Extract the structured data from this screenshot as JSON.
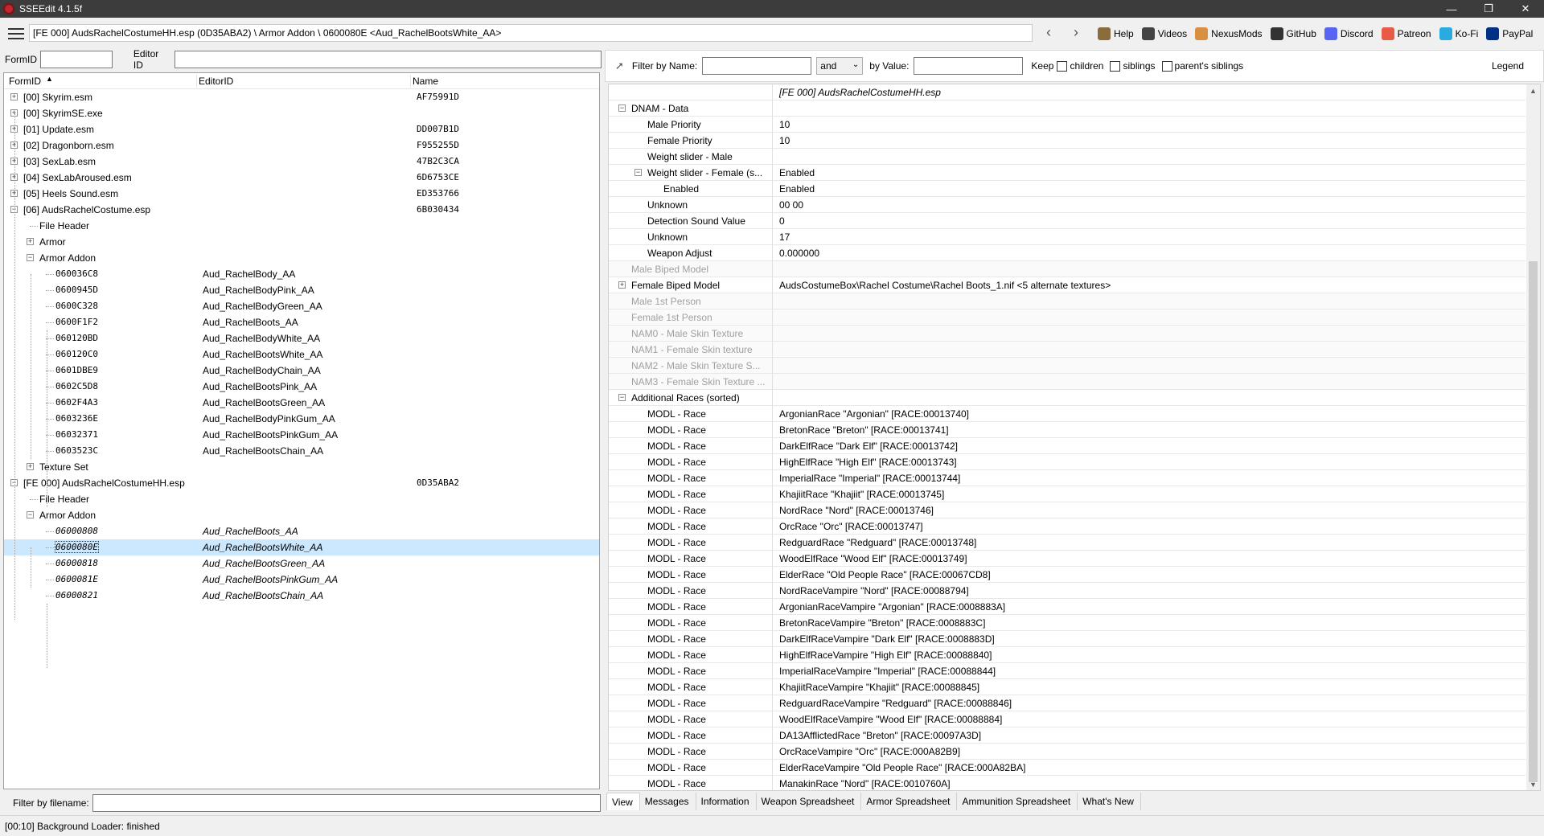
{
  "window": {
    "title": "SSEEdit 4.1.5f"
  },
  "toolbar": {
    "path": "[FE 000] AudsRachelCostumeHH.esp (0D35ABA2) \\ Armor Addon \\ 0600080E <Aud_RachelBootsWhite_AA>",
    "back_glyph": "‹",
    "forward_glyph": "›",
    "links": [
      {
        "label": "Help",
        "color": "#8a6d3b"
      },
      {
        "label": "Videos",
        "color": "#444444"
      },
      {
        "label": "NexusMods",
        "color": "#d98f40"
      },
      {
        "label": "GitHub",
        "color": "#333333"
      },
      {
        "label": "Discord",
        "color": "#5865f2"
      },
      {
        "label": "Patreon",
        "color": "#e85b46"
      },
      {
        "label": "Ko-Fi",
        "color": "#29abe0"
      },
      {
        "label": "PayPal",
        "color": "#003087"
      }
    ]
  },
  "left": {
    "formid_label": "FormID",
    "editorid_label": "Editor ID",
    "columns": [
      "FormID",
      "EditorID",
      "Name"
    ],
    "filename_label": "Filter by filename:",
    "rows": [
      {
        "c1": "[00] Skyrim.esm",
        "c2": "",
        "c3": "AF75991D"
      },
      {
        "c1": "[00] SkyrimSE.exe",
        "c2": "",
        "c3": ""
      },
      {
        "c1": "[01] Update.esm",
        "c2": "",
        "c3": "DD007B1D"
      },
      {
        "c1": "[02] Dragonborn.esm",
        "c2": "",
        "c3": "F955255D"
      },
      {
        "c1": "[03] SexLab.esm",
        "c2": "",
        "c3": "47B2C3CA"
      },
      {
        "c1": "[04] SexLabAroused.esm",
        "c2": "",
        "c3": "6D6753CE"
      },
      {
        "c1": "[05] Heels Sound.esm",
        "c2": "",
        "c3": "ED353766"
      },
      {
        "c1": "[06] AudsRachelCostume.esp",
        "c2": "",
        "c3": "6B030434"
      },
      {
        "c1": "File Header",
        "c2": "",
        "c3": ""
      },
      {
        "c1": "Armor",
        "c2": "",
        "c3": ""
      },
      {
        "c1": "Armor Addon",
        "c2": "",
        "c3": ""
      },
      {
        "c1": "060036C8",
        "c2": "Aud_RachelBody_AA",
        "c3": ""
      },
      {
        "c1": "0600945D",
        "c2": "Aud_RachelBodyPink_AA",
        "c3": ""
      },
      {
        "c1": "0600C328",
        "c2": "Aud_RachelBodyGreen_AA",
        "c3": ""
      },
      {
        "c1": "0600F1F2",
        "c2": "Aud_RachelBoots_AA",
        "c3": ""
      },
      {
        "c1": "060120BD",
        "c2": "Aud_RachelBodyWhite_AA",
        "c3": ""
      },
      {
        "c1": "060120C0",
        "c2": "Aud_RachelBootsWhite_AA",
        "c3": ""
      },
      {
        "c1": "0601DBE9",
        "c2": "Aud_RachelBodyChain_AA",
        "c3": ""
      },
      {
        "c1": "0602C5D8",
        "c2": "Aud_RachelBootsPink_AA",
        "c3": ""
      },
      {
        "c1": "0602F4A3",
        "c2": "Aud_RachelBootsGreen_AA",
        "c3": ""
      },
      {
        "c1": "0603236E",
        "c2": "Aud_RachelBodyPinkGum_AA",
        "c3": ""
      },
      {
        "c1": "06032371",
        "c2": "Aud_RachelBootsPinkGum_AA",
        "c3": ""
      },
      {
        "c1": "0603523C",
        "c2": "Aud_RachelBootsChain_AA",
        "c3": ""
      },
      {
        "c1": "Texture Set",
        "c2": "",
        "c3": ""
      },
      {
        "c1": "[FE 000] AudsRachelCostumeHH.esp",
        "c2": "",
        "c3": "0D35ABA2"
      },
      {
        "c1": "File Header",
        "c2": "",
        "c3": ""
      },
      {
        "c1": "Armor Addon",
        "c2": "",
        "c3": ""
      },
      {
        "c1": "06000808",
        "c2": "Aud_RachelBoots_AA",
        "c3": ""
      },
      {
        "c1": "0600080E",
        "c2": "Aud_RachelBootsWhite_AA",
        "c3": ""
      },
      {
        "c1": "06000818",
        "c2": "Aud_RachelBootsGreen_AA",
        "c3": ""
      },
      {
        "c1": "0600081E",
        "c2": "Aud_RachelBootsPinkGum_AA",
        "c3": ""
      },
      {
        "c1": "06000821",
        "c2": "Aud_RachelBootsChain_AA",
        "c3": ""
      }
    ]
  },
  "right": {
    "filter_name_label": "Filter by Name:",
    "and_value": "and",
    "by_value_label": "by Value:",
    "keep_label": "Keep",
    "children_label": "children",
    "siblings_label": "siblings",
    "parents_siblings_label": "parent's siblings",
    "legend_label": "Legend",
    "header_value": "[FE 000] AudsRachelCostumeHH.esp",
    "rows": [
      {
        "k": "DNAM - Data",
        "v": ""
      },
      {
        "k": "Male Priority",
        "v": "10"
      },
      {
        "k": "Female Priority",
        "v": "10"
      },
      {
        "k": "Weight slider - Male",
        "v": ""
      },
      {
        "k": "Weight slider - Female (s...",
        "v": "Enabled"
      },
      {
        "k": "Enabled",
        "v": "Enabled"
      },
      {
        "k": "Unknown",
        "v": "00 00"
      },
      {
        "k": "Detection Sound Value",
        "v": "0"
      },
      {
        "k": "Unknown",
        "v": "17"
      },
      {
        "k": "Weapon Adjust",
        "v": "0.000000"
      },
      {
        "k": "Male Biped Model",
        "v": ""
      },
      {
        "k": "Female Biped Model",
        "v": "AudsCostumeBox\\Rachel Costume\\Rachel Boots_1.nif <5 alternate textures>"
      },
      {
        "k": "Male 1st Person",
        "v": ""
      },
      {
        "k": "Female 1st Person",
        "v": ""
      },
      {
        "k": "NAM0 - Male Skin Texture",
        "v": ""
      },
      {
        "k": "NAM1 - Female Skin texture",
        "v": ""
      },
      {
        "k": "NAM2 - Male Skin Texture S...",
        "v": ""
      },
      {
        "k": "NAM3 - Female Skin Texture ...",
        "v": ""
      },
      {
        "k": "Additional Races (sorted)",
        "v": ""
      },
      {
        "k": "MODL - Race",
        "v": "ArgonianRace \"Argonian\" [RACE:00013740]"
      },
      {
        "k": "MODL - Race",
        "v": "BretonRace \"Breton\" [RACE:00013741]"
      },
      {
        "k": "MODL - Race",
        "v": "DarkElfRace \"Dark Elf\" [RACE:00013742]"
      },
      {
        "k": "MODL - Race",
        "v": "HighElfRace \"High Elf\" [RACE:00013743]"
      },
      {
        "k": "MODL - Race",
        "v": "ImperialRace \"Imperial\" [RACE:00013744]"
      },
      {
        "k": "MODL - Race",
        "v": "KhajiitRace \"Khajiit\" [RACE:00013745]"
      },
      {
        "k": "MODL - Race",
        "v": "NordRace \"Nord\" [RACE:00013746]"
      },
      {
        "k": "MODL - Race",
        "v": "OrcRace \"Orc\" [RACE:00013747]"
      },
      {
        "k": "MODL - Race",
        "v": "RedguardRace \"Redguard\" [RACE:00013748]"
      },
      {
        "k": "MODL - Race",
        "v": "WoodElfRace \"Wood Elf\" [RACE:00013749]"
      },
      {
        "k": "MODL - Race",
        "v": "ElderRace \"Old People Race\" [RACE:00067CD8]"
      },
      {
        "k": "MODL - Race",
        "v": "NordRaceVampire \"Nord\" [RACE:00088794]"
      },
      {
        "k": "MODL - Race",
        "v": "ArgonianRaceVampire \"Argonian\" [RACE:0008883A]"
      },
      {
        "k": "MODL - Race",
        "v": "BretonRaceVampire \"Breton\" [RACE:0008883C]"
      },
      {
        "k": "MODL - Race",
        "v": "DarkElfRaceVampire \"Dark Elf\" [RACE:0008883D]"
      },
      {
        "k": "MODL - Race",
        "v": "HighElfRaceVampire \"High Elf\" [RACE:00088840]"
      },
      {
        "k": "MODL - Race",
        "v": "ImperialRaceVampire \"Imperial\" [RACE:00088844]"
      },
      {
        "k": "MODL - Race",
        "v": "KhajiitRaceVampire \"Khajiit\" [RACE:00088845]"
      },
      {
        "k": "MODL - Race",
        "v": "RedguardRaceVampire \"Redguard\" [RACE:00088846]"
      },
      {
        "k": "MODL - Race",
        "v": "WoodElfRaceVampire \"Wood Elf\" [RACE:00088884]"
      },
      {
        "k": "MODL - Race",
        "v": "DA13AfflictedRace \"Breton\" [RACE:00097A3D]"
      },
      {
        "k": "MODL - Race",
        "v": "OrcRaceVampire \"Orc\" [RACE:000A82B9]"
      },
      {
        "k": "MODL - Race",
        "v": "ElderRaceVampire \"Old People Race\" [RACE:000A82BA]"
      },
      {
        "k": "MODL - Race",
        "v": "ManakinRace \"Nord\" [RACE:0010760A]"
      }
    ],
    "tabs": [
      "View",
      "Messages",
      "Information",
      "Weapon Spreadsheet",
      "Armor Spreadsheet",
      "Ammunition Spreadsheet",
      "What's New"
    ]
  },
  "status": {
    "text": "[00:10] Background Loader: finished"
  }
}
